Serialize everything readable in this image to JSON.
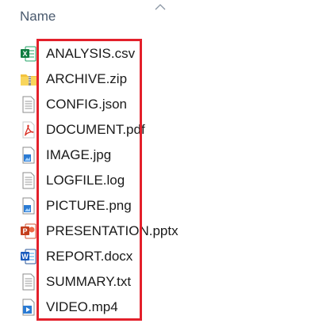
{
  "header": {
    "column_name": "Name",
    "sort_icon": "chevron-up-icon"
  },
  "files": [
    {
      "name": "ANALYSIS.csv",
      "icon": "excel-icon"
    },
    {
      "name": "ARCHIVE.zip",
      "icon": "zip-folder-icon"
    },
    {
      "name": "CONFIG.json",
      "icon": "text-document-icon"
    },
    {
      "name": "DOCUMENT.pdf",
      "icon": "pdf-icon"
    },
    {
      "name": "IMAGE.jpg",
      "icon": "image-file-icon"
    },
    {
      "name": "LOGFILE.log",
      "icon": "text-document-icon"
    },
    {
      "name": "PICTURE.png",
      "icon": "image-file-icon"
    },
    {
      "name": "PRESENTATION.pptx",
      "icon": "powerpoint-icon"
    },
    {
      "name": "REPORT.docx",
      "icon": "word-icon"
    },
    {
      "name": "SUMMARY.txt",
      "icon": "text-document-icon"
    },
    {
      "name": "VIDEO.mp4",
      "icon": "video-file-icon"
    }
  ],
  "colors": {
    "highlight": "#e3202b",
    "header_text": "#4a5a6e",
    "file_text": "#1a1a1a"
  }
}
